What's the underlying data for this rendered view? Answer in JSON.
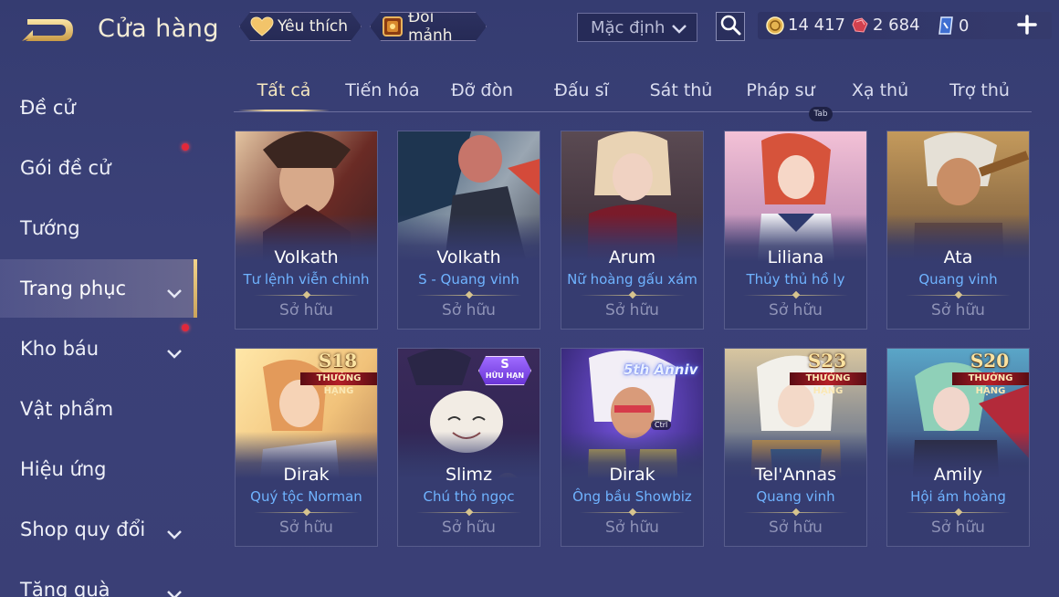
{
  "header": {
    "title": "Cửa hàng",
    "favorites_label": "Yêu thích",
    "fragments_label": "Đổi mảnh",
    "sort_value": "Mặc định",
    "currencies": {
      "coins": "14 417",
      "rubies": "2 684",
      "vouchers": "0"
    }
  },
  "sidebar": {
    "items": [
      {
        "label": "Đề cử"
      },
      {
        "label": "Gói đề cử"
      },
      {
        "label": "Tướng"
      },
      {
        "label": "Trang phục"
      },
      {
        "label": "Kho báu"
      },
      {
        "label": "Vật phẩm"
      },
      {
        "label": "Hiệu ứng"
      },
      {
        "label": "Shop quy đổi"
      },
      {
        "label": "Tăng quà"
      }
    ]
  },
  "tabs": [
    "Tất cả",
    "Tiến hóa",
    "Đỡ đòn",
    "Đấu sĩ",
    "Sát thủ",
    "Pháp sư",
    "Xạ thủ",
    "Trợ thủ"
  ],
  "tab_hint": "Tab",
  "cards": [
    {
      "hero": "Volkath",
      "skin": "Tư lệnh viễn chinh",
      "status": "Sở hữu"
    },
    {
      "hero": "Volkath",
      "skin": "S - Quang vinh",
      "status": "Sở hữu"
    },
    {
      "hero": "Arum",
      "skin": "Nữ hoàng gấu xám",
      "status": "Sở hữu"
    },
    {
      "hero": "Liliana",
      "skin": "Thủy thủ hồ ly",
      "status": "Sở hữu"
    },
    {
      "hero": "Ata",
      "skin": "Quang vinh",
      "status": "Sở hữu"
    },
    {
      "hero": "Dirak",
      "skin": "Quý tộc Norman",
      "status": "Sở hữu",
      "badge_season": "S18",
      "badge_rank": "THƯỞNG HẠNG"
    },
    {
      "hero": "Slimz",
      "skin": "Chú thỏ ngọc",
      "status": "Sở hữu",
      "badge_limited_top": "S",
      "badge_limited_bottom": "HỮU HẠN"
    },
    {
      "hero": "Dirak",
      "skin": "Ông bầu Showbiz",
      "status": "Sở hữu",
      "badge_anniv": "5th Anniv",
      "ctrl_hint": "Ctrl"
    },
    {
      "hero": "Tel'Annas",
      "skin": "Quang vinh",
      "status": "Sở hữu",
      "badge_season": "S23",
      "badge_rank": "THƯỞNG HẠNG"
    },
    {
      "hero": "Amily",
      "skin": "Hội ám hoàng",
      "status": "Sở hữu",
      "badge_season": "S20",
      "badge_rank": "THƯỞNG HẠNG"
    }
  ],
  "colors": {
    "background": "#393f76",
    "skin_name": "#6fb3ff",
    "active_tab": "#f6e8c0",
    "notification_dot": "#e2283a"
  }
}
